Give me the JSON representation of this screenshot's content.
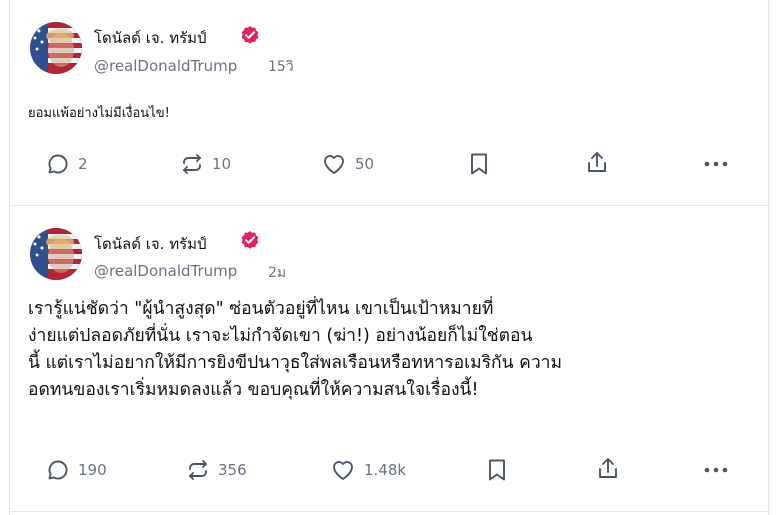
{
  "posts": [
    {
      "author_name": "โดนัลด์ เจ. ทรัมป์",
      "handle": "@realDonaldTrump",
      "time": "15วิ",
      "text": "ยอมแพ้อย่างไม่มีเงื่อนไข!",
      "replies": "2",
      "reposts": "10",
      "likes": "50"
    },
    {
      "author_name": "โดนัลด์ เจ. ทรัมป์",
      "handle": "@realDonaldTrump",
      "time": "2ม",
      "text_lines": [
        "เรารู้แน่ชัดว่า \"ผู้นำสูงสุด\" ซ่อนตัวอยู่ที่ไหน เขาเป็นเป้าหมายที่",
        "ง่ายแต่ปลอดภัยที่นั่น เราจะไม่กำจัดเขา (ฆ่า!) อย่างน้อยก็ไม่ใช่ตอน",
        "นี้ แต่เราไม่อยากให้มีการยิงขีปนาวุธใส่พลเรือนหรือทหารอเมริกัน ความ",
        "อดทนของเราเริ่มหมดลงแล้ว ขอบคุณที่ให้ความสนใจเรื่องนี้!"
      ],
      "replies": "190",
      "reposts": "356",
      "likes": "1.48k"
    }
  ],
  "colors": {
    "verified": "#e0245e",
    "muted": "#6b7280",
    "icon": "#4b5563"
  },
  "icons": [
    "reply-icon",
    "repost-icon",
    "like-icon",
    "bookmark-icon",
    "share-icon",
    "more-icon",
    "verified-icon"
  ]
}
